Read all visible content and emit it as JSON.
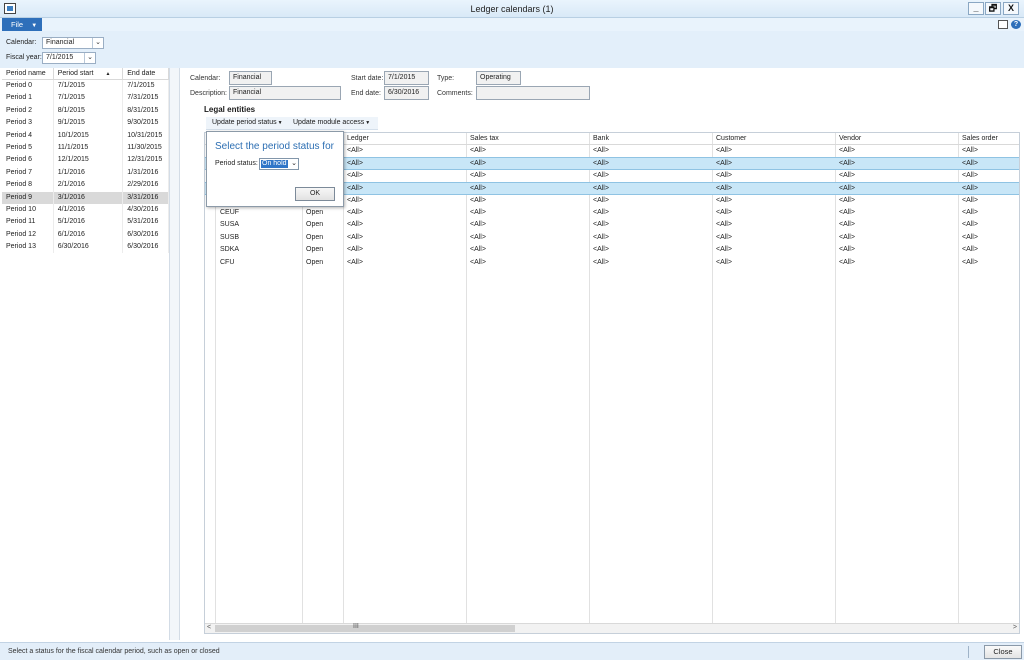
{
  "window": {
    "title": "Ledger calendars (1)",
    "minimize": "_",
    "restore": "🗗",
    "close": "X"
  },
  "menu": {
    "file_label": "File",
    "file_caret": "▼",
    "help_glyph": "?"
  },
  "filters": {
    "calendar_label": "Calendar:",
    "calendar_value": "Financial",
    "fiscal_year_label": "Fiscal year:",
    "fiscal_year_value": "7/1/2015",
    "dropdown_glyph": "⌄"
  },
  "periods": {
    "columns": [
      "Period name",
      "Period start",
      "End date"
    ],
    "sort_indicator": "▲",
    "rows": [
      [
        "Period 0",
        "7/1/2015",
        "7/1/2015"
      ],
      [
        "Period 1",
        "7/1/2015",
        "7/31/2015"
      ],
      [
        "Period 2",
        "8/1/2015",
        "8/31/2015"
      ],
      [
        "Period 3",
        "9/1/2015",
        "9/30/2015"
      ],
      [
        "Period 4",
        "10/1/2015",
        "10/31/2015"
      ],
      [
        "Period 5",
        "11/1/2015",
        "11/30/2015"
      ],
      [
        "Period 6",
        "12/1/2015",
        "12/31/2015"
      ],
      [
        "Period 7",
        "1/1/2016",
        "1/31/2016"
      ],
      [
        "Period 8",
        "2/1/2016",
        "2/29/2016"
      ],
      [
        "Period 9",
        "3/1/2016",
        "3/31/2016"
      ],
      [
        "Period 10",
        "4/1/2016",
        "4/30/2016"
      ],
      [
        "Period 11",
        "5/1/2016",
        "5/31/2016"
      ],
      [
        "Period 12",
        "6/1/2016",
        "6/30/2016"
      ],
      [
        "Period 13",
        "6/30/2016",
        "6/30/2016"
      ]
    ],
    "selected_index": 9
  },
  "details": {
    "calendar_label": "Calendar:",
    "calendar_value": "Financial",
    "description_label": "Description:",
    "description_value": "Financial",
    "start_date_label": "Start date:",
    "start_date_value": "7/1/2015",
    "end_date_label": "End date:",
    "end_date_value": "6/30/2016",
    "type_label": "Type:",
    "type_value": "Operating",
    "comments_label": "Comments:",
    "comments_value": ""
  },
  "legal_entities": {
    "title": "Legal entities",
    "update_period_status": "Update period status",
    "update_module_access": "Update module access",
    "arrow": "▼",
    "columns": [
      "Ledger",
      "Sales tax",
      "Bank",
      "Customer",
      "Vendor",
      "Sales order"
    ],
    "rows": [
      {
        "entity": "",
        "status": "",
        "values": [
          "<All>",
          "<All>",
          "<All>",
          "<All>",
          "<All>",
          "<All>"
        ]
      },
      {
        "entity": "",
        "status": "",
        "values": [
          "<All>",
          "<All>",
          "<All>",
          "<All>",
          "<All>",
          "<All>"
        ]
      },
      {
        "entity": "",
        "status": "",
        "values": [
          "<All>",
          "<All>",
          "<All>",
          "<All>",
          "<All>",
          "<All>"
        ]
      },
      {
        "entity": "",
        "status": "",
        "values": [
          "<All>",
          "<All>",
          "<All>",
          "<All>",
          "<All>",
          "<All>"
        ]
      },
      {
        "entity": "",
        "status": "",
        "values": [
          "<All>",
          "<All>",
          "<All>",
          "<All>",
          "<All>",
          "<All>"
        ]
      },
      {
        "entity": "CEUF",
        "status": "Open",
        "values": [
          "<All>",
          "<All>",
          "<All>",
          "<All>",
          "<All>",
          "<All>"
        ]
      },
      {
        "entity": "SUSA",
        "status": "Open",
        "values": [
          "<All>",
          "<All>",
          "<All>",
          "<All>",
          "<All>",
          "<All>"
        ]
      },
      {
        "entity": "SUSB",
        "status": "Open",
        "values": [
          "<All>",
          "<All>",
          "<All>",
          "<All>",
          "<All>",
          "<All>"
        ]
      },
      {
        "entity": "SDKA",
        "status": "Open",
        "values": [
          "<All>",
          "<All>",
          "<All>",
          "<All>",
          "<All>",
          "<All>"
        ]
      },
      {
        "entity": "CFU",
        "status": "Open",
        "values": [
          "<All>",
          "<All>",
          "<All>",
          "<All>",
          "<All>",
          "<All>"
        ]
      }
    ],
    "selected_rows": [
      1,
      3
    ],
    "scroll_grip": "III",
    "scroll_left": "<",
    "scroll_right": ">"
  },
  "popup": {
    "title": "Select the period status for",
    "period_status_label": "Period status:",
    "period_status_value": "On hold",
    "ok_label": "OK"
  },
  "status": {
    "text": "Select a status for the fiscal calendar period, such as open or closed",
    "close_label": "Close"
  },
  "colors": {
    "accent": "#2e6fba",
    "selection": "#c8e6f7",
    "panel": "#e3effa"
  }
}
